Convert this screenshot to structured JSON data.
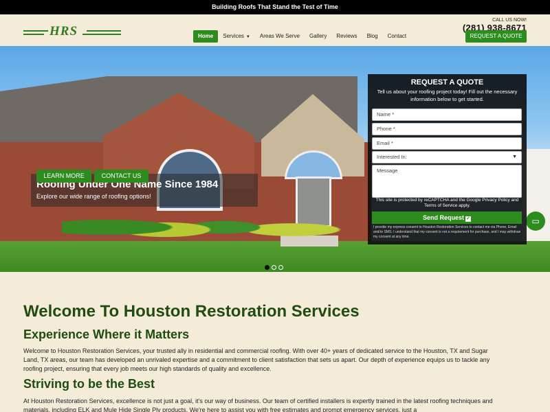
{
  "topbar": {
    "text": "Building Roofs That Stand the Test of Time"
  },
  "header": {
    "logo_text": "HRS",
    "call_label": "CALL US NOW!",
    "phone": "(281) 938-8671",
    "quote_button": "REQUEST A QUOTE"
  },
  "nav": {
    "items": [
      {
        "label": "Home",
        "active": true
      },
      {
        "label": "Services",
        "has_dropdown": true
      },
      {
        "label": "Areas We Serve"
      },
      {
        "label": "Gallery"
      },
      {
        "label": "Reviews"
      },
      {
        "label": "Blog"
      },
      {
        "label": "Contact"
      }
    ]
  },
  "hero": {
    "title": "Roofing Under One Name Since 1984",
    "subtitle": "Explore our wide range of roofing options!",
    "learn_more": "LEARN MORE",
    "contact_us": "CONTACT US",
    "slides": 3,
    "active_slide": 1
  },
  "quote_form": {
    "title": "REQUEST A QUOTE",
    "intro": "Tell us about your roofing project today! Fill out the necessary information below to get started.",
    "name_placeholder": "Name *",
    "phone_placeholder": "Phone *",
    "email_placeholder": "Email *",
    "interest_value": "Interested In:",
    "message_placeholder": "Message",
    "recaptcha": "This site is protected by reCAPTCHA and the Google Privacy Policy and Terms of Service apply.",
    "send_button": "Send Request",
    "consent": "I provide my express consent to Houston Restoration Services to contact me via Phone, Email and/or SMS. I understand that my consent is not a requirement for purchase, and I may withdraw my consent at any time."
  },
  "content": {
    "heading": "Welcome To Houston Restoration Services",
    "subheading1": "Experience Where it Matters",
    "paragraph1": "Welcome to Houston Restoration Services, your trusted ally in residential and commercial roofing. With over 40+ years of dedicated service to the Houston, TX and Sugar Land, TX areas, our team has developed an unrivaled expertise and a commitment to client satisfaction that sets us apart. Our depth of experience equips us to tackle any roofing project, ensuring that every job meets our high standards of quality and excellence.",
    "subheading2": "Striving to be the Best",
    "paragraph2": "At Houston Restoration Services, excellence is not just a goal, it's our way of business. Our team of certified installers is expertly trained in the latest roofing techniques and materials, including ELK and Mule Hide Single Ply products. We're here to assist you with free estimates and prompt emergency services, just a"
  },
  "colors": {
    "brand_green": "#2e8b1e",
    "heading_green": "#1f4d0f",
    "background": "#f5ebd9"
  },
  "icons": {
    "chat": "chat-bubble-icon",
    "dropdown": "chevron-down-icon",
    "check": "checkbox-icon"
  }
}
